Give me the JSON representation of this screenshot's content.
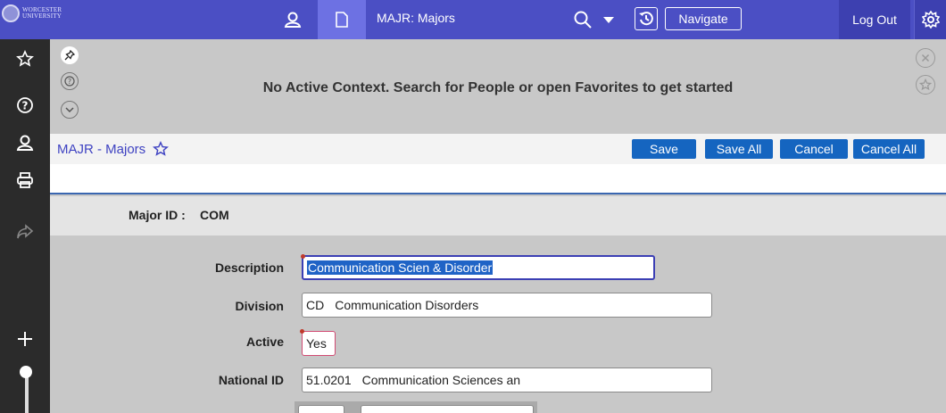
{
  "brand": {
    "logo_text_line1": "WORCESTER",
    "logo_text_line2": "UNIVERSITY"
  },
  "topbar": {
    "page_tab_title": "MAJR: Majors",
    "navigate_label": "Navigate",
    "logout_label": "Log Out",
    "icons": [
      "person-icon",
      "document-icon",
      "search-icon",
      "caret-down-icon",
      "history-icon",
      "gear-icon"
    ]
  },
  "left_rail": {
    "icons": [
      "star-icon",
      "help-icon",
      "person-icon",
      "print-icon",
      "share-icon",
      "plus-icon"
    ]
  },
  "context": {
    "message": "No Active Context. Search for People or open Favorites to get started"
  },
  "page_header": {
    "title": "MAJR - Majors",
    "buttons": {
      "save": "Save",
      "save_all": "Save All",
      "cancel": "Cancel",
      "cancel_all": "Cancel All"
    }
  },
  "key_block": {
    "label": "Major ID :",
    "value": "COM"
  },
  "form": {
    "description": {
      "label": "Description",
      "value": "Communication Scien & Disorder"
    },
    "division": {
      "label": "Division",
      "code": "CD",
      "name": "Communication Disorders"
    },
    "active": {
      "label": "Active",
      "value": "Yes"
    },
    "national_id": {
      "label": "National ID",
      "code": "51.0201",
      "name": "Communication Sciences an"
    }
  },
  "colors": {
    "topbar": "#4b4fc4",
    "accent": "#1565c0",
    "left_rail": "#2b2b2b",
    "title_link": "#3f43c2"
  }
}
